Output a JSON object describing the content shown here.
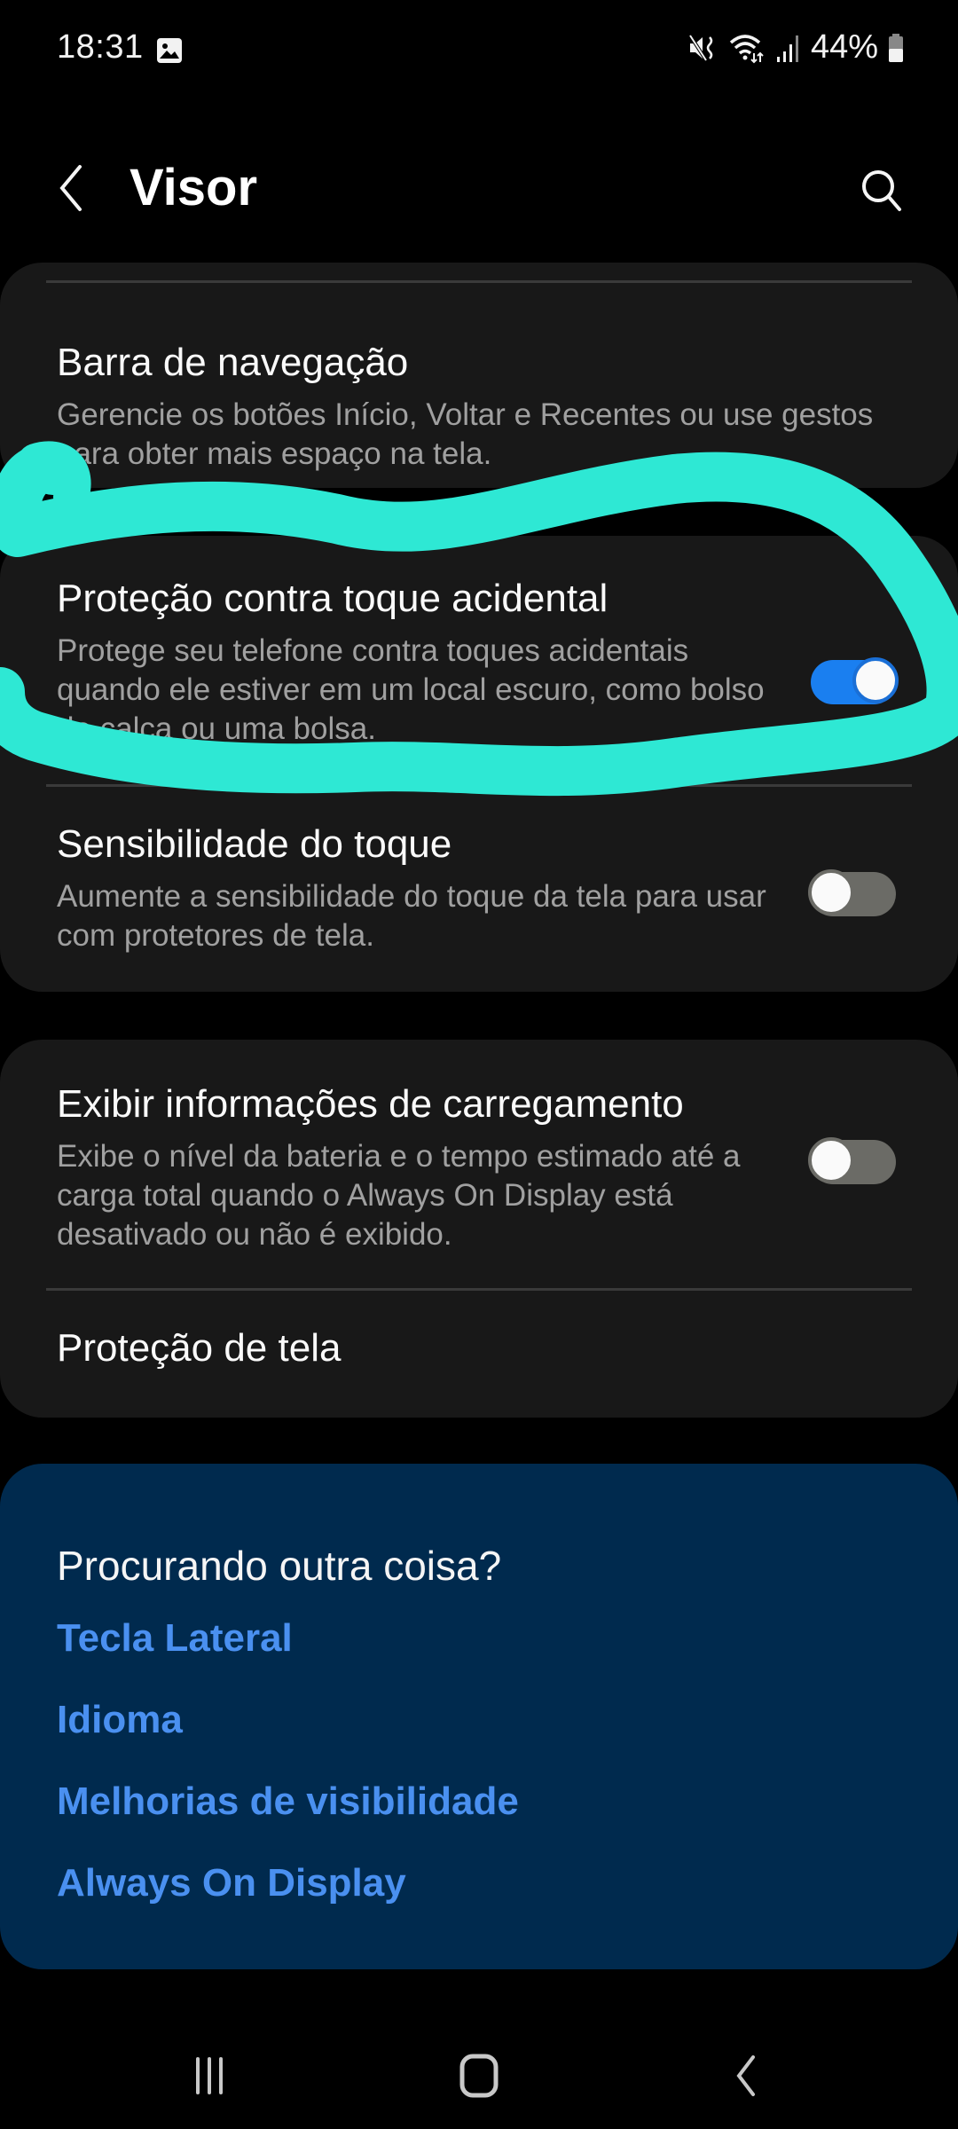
{
  "status_bar": {
    "time": "18:31",
    "battery": "44%",
    "icons": [
      "gallery-icon",
      "mute-icon",
      "wifi-icon",
      "signal-icon",
      "battery-icon"
    ]
  },
  "header": {
    "title": "Visor",
    "back_icon": "chevron-left-icon",
    "search_icon": "search-icon"
  },
  "settings": {
    "navigation_bar": {
      "title": "Barra de navegação",
      "subtitle": "Gerencie os botões Início, Voltar e Recentes ou use gestos para obter mais espaço na tela."
    },
    "accidental_touch": {
      "title": "Proteção contra toque acidental",
      "subtitle": "Protege seu telefone contra toques acidentais quando ele estiver em um local escuro, como bolso de calça ou uma bolsa.",
      "enabled": true
    },
    "touch_sensitivity": {
      "title": "Sensibilidade do toque",
      "subtitle": "Aumente a sensibilidade do toque da tela para usar com protetores de tela.",
      "enabled": false
    },
    "charging_info": {
      "title": "Exibir informações de carregamento",
      "subtitle": "Exibe o nível da bateria e o tempo estimado até a carga total quando o Always On Display está desativado ou não é exibido.",
      "enabled": false
    },
    "screen_saver": {
      "title": "Proteção de tela"
    }
  },
  "related": {
    "title": "Procurando outra coisa?",
    "links": [
      "Tecla Lateral",
      "Idioma",
      "Melhorias de visibilidade",
      "Always On Display"
    ]
  },
  "nav_bar": {
    "recents_icon": "recents-icon",
    "home_icon": "home-icon",
    "back_icon": "back-icon"
  },
  "colors": {
    "accent": "#1a7ff0",
    "link": "#4a90f0",
    "annotation": "#2ee8d4",
    "card": "#181818",
    "related_card": "#002a4e"
  }
}
